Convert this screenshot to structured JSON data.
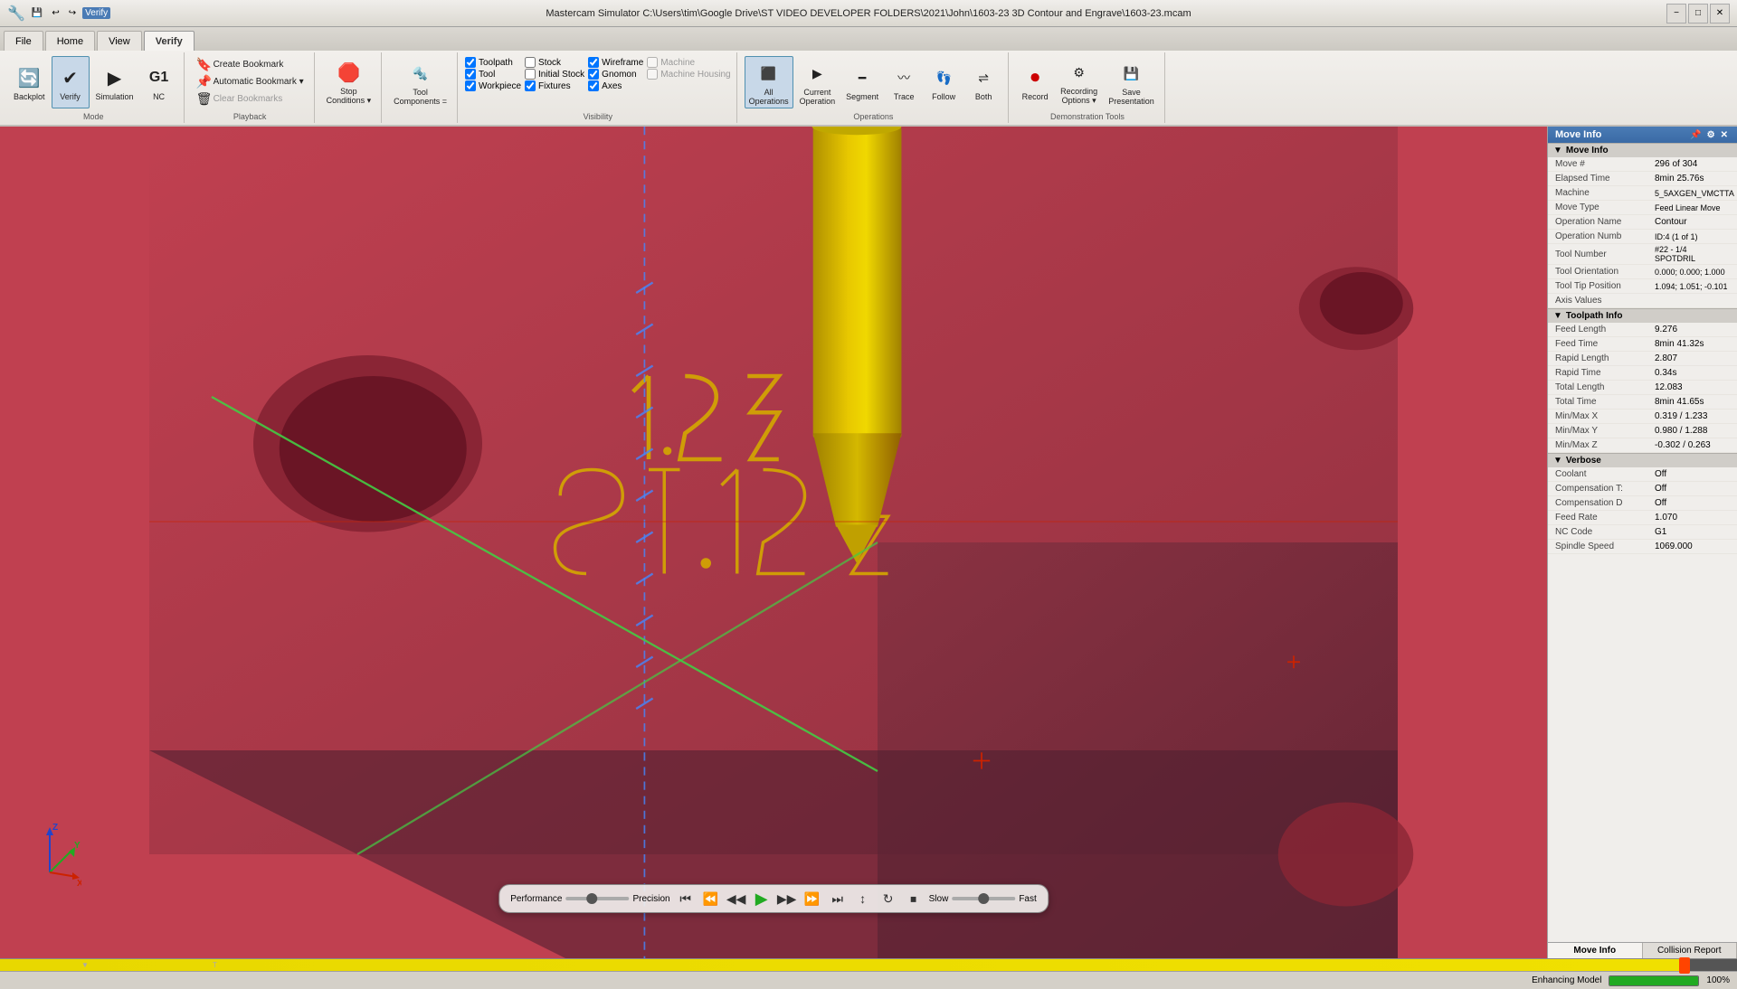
{
  "titlebar": {
    "title": "Mastercam Simulator  C:\\Users\\tim\\Google Drive\\ST VIDEO DEVELOPER FOLDERS\\2021\\John\\1603-23 3D Contour and Engrave\\1603-23.mcam",
    "min_btn": "−",
    "max_btn": "□",
    "close_btn": "✕"
  },
  "ribbon": {
    "tabs": [
      "Backplot",
      "Verify",
      "Simulation",
      "NC",
      "Home",
      "View",
      "Verify"
    ],
    "active_tab": "Verify",
    "groups": {
      "mode": {
        "label": "Mode",
        "buttons": [
          "Backplot",
          "Verify",
          "Simulation",
          "NC"
        ]
      },
      "playback": {
        "label": "Playback",
        "items": [
          "Create Bookmark",
          "Automatic Bookmark",
          "Clear Bookmarks"
        ]
      },
      "g1": {
        "label": "G1"
      },
      "stop_conditions": {
        "label": "Stop Conditions"
      },
      "tool_components": {
        "label": "Tool Components ="
      },
      "visibility": {
        "label": "Visibility",
        "checkboxes": [
          {
            "label": "Toolpath",
            "checked": true
          },
          {
            "label": "Tool",
            "checked": true
          },
          {
            "label": "Workpiece",
            "checked": true
          },
          {
            "label": "Stock",
            "checked": false
          },
          {
            "label": "Initial Stock",
            "checked": false
          },
          {
            "label": "Fixtures",
            "checked": true
          },
          {
            "label": "Wireframe",
            "checked": true
          },
          {
            "label": "Gnomon",
            "checked": true
          },
          {
            "label": "Axes",
            "checked": true
          },
          {
            "label": "Machine",
            "checked": false
          },
          {
            "label": "Machine Housing",
            "checked": false
          }
        ]
      },
      "operations": {
        "label": "Operations",
        "buttons": [
          "All Operations",
          "Current Operation",
          "Segment",
          "Trace",
          "Follow",
          "Both"
        ]
      },
      "toolpath": {
        "label": "Toolpath",
        "buttons": [
          "Record",
          "Recording Options",
          "Save Presentation"
        ]
      },
      "demonstration_tools": {
        "label": "Demonstration Tools"
      }
    }
  },
  "move_info": {
    "panel_title": "Move Info",
    "sections": {
      "move_info": {
        "title": "Move Info",
        "rows": [
          {
            "label": "Move #",
            "value": "296 of 304"
          },
          {
            "label": "Elapsed Time",
            "value": "8min 25.76s"
          },
          {
            "label": "Machine",
            "value": "5_5AXGEN_VMCTTA"
          },
          {
            "label": "Move Type",
            "value": "Feed Linear Move"
          },
          {
            "label": "Operation Name",
            "value": "Contour"
          },
          {
            "label": "Operation Numb",
            "value": "ID:4 (1 of 1)"
          },
          {
            "label": "Tool Number",
            "value": "#22 - 1/4 SPOTDRIL"
          },
          {
            "label": "Tool Orientation",
            "value": "0.000; 0.000; 1.000"
          },
          {
            "label": "Tool Tip Position",
            "value": "1.094; 1.051; -0.101"
          },
          {
            "label": "Axis Values",
            "value": ""
          }
        ]
      },
      "toolpath_info": {
        "title": "Toolpath Info",
        "rows": [
          {
            "label": "Feed Length",
            "value": "9.276"
          },
          {
            "label": "Feed Time",
            "value": "8min 41.32s"
          },
          {
            "label": "Rapid Length",
            "value": "2.807"
          },
          {
            "label": "Rapid Time",
            "value": "0.34s"
          },
          {
            "label": "Total Length",
            "value": "12.083"
          },
          {
            "label": "Total Time",
            "value": "8min 41.65s"
          },
          {
            "label": "Min/Max X",
            "value": "0.319 / 1.233"
          },
          {
            "label": "Min/Max Y",
            "value": "0.980 / 1.288"
          },
          {
            "label": "Min/Max Z",
            "value": "-0.302 / 0.263"
          }
        ]
      },
      "verbose": {
        "title": "Verbose",
        "rows": [
          {
            "label": "Coolant",
            "value": "Off"
          },
          {
            "label": "Compensation T:",
            "value": "Off"
          },
          {
            "label": "Compensation D",
            "value": "Off"
          },
          {
            "label": "Feed Rate",
            "value": "1.070"
          },
          {
            "label": "NC Code",
            "value": "G1"
          },
          {
            "label": "Spindle Speed",
            "value": "1069.000"
          }
        ]
      }
    }
  },
  "playback": {
    "performance_label": "Performance",
    "precision_label": "Precision",
    "slow_label": "Slow",
    "fast_label": "Fast",
    "buttons": [
      "⏮",
      "⏪",
      "◀◀",
      "▶",
      "▶▶",
      "⏩",
      "⏭"
    ],
    "extra_btns": [
      "↕",
      "↻",
      "⏹"
    ]
  },
  "panel_tabs": {
    "tabs": [
      "Move Info",
      "Collision Report"
    ],
    "active": "Move Info"
  },
  "status_bar": {
    "left": "",
    "enhancing_model": "Enhancing Model",
    "progress_pct": 100
  },
  "axis_gizmo": {
    "x_color": "#cc2200",
    "y_color": "#22aa22",
    "z_color": "#2244cc",
    "x_label": "X",
    "y_label": "Y",
    "z_label": "Z"
  }
}
